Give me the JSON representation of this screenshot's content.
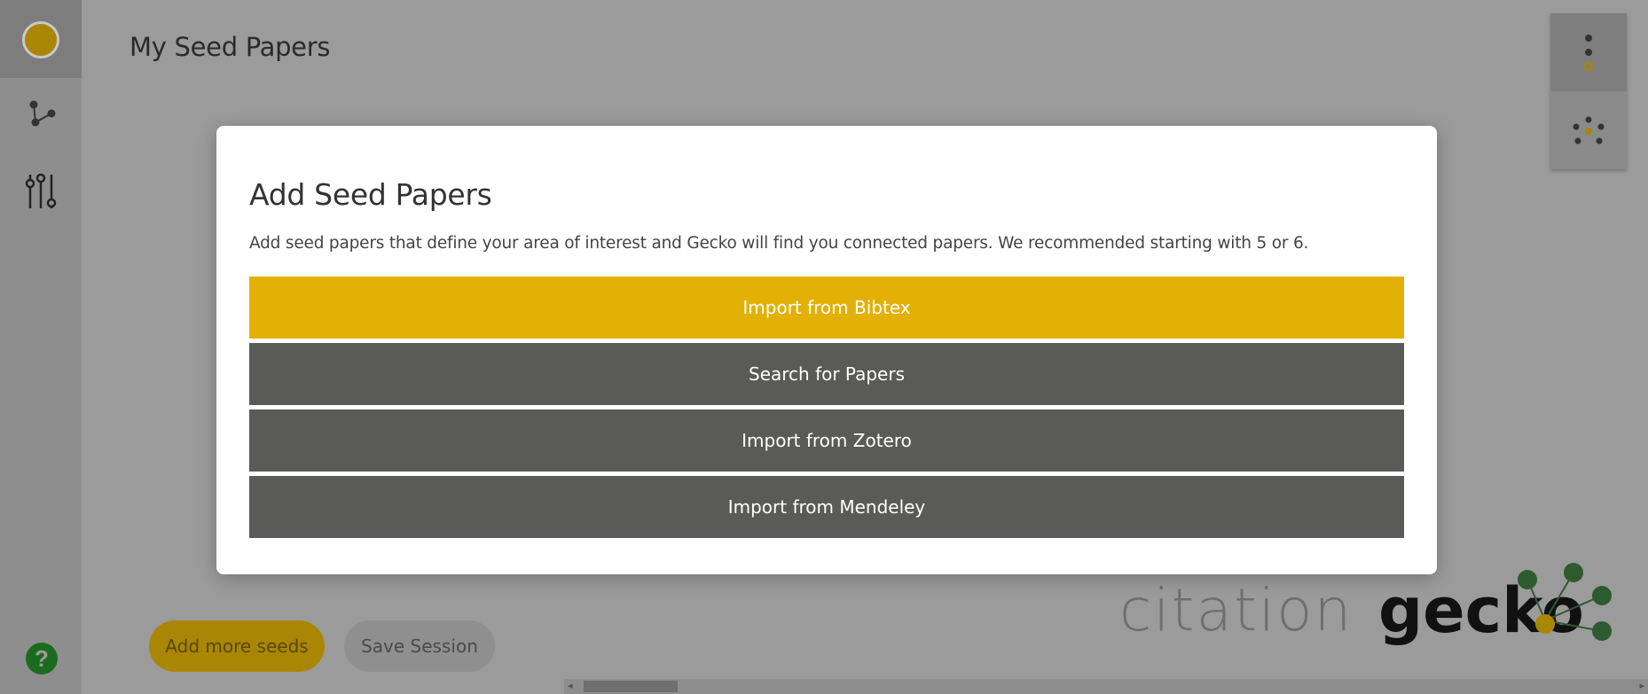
{
  "app": {
    "page_title": "My Seed Papers"
  },
  "sidebar": {
    "items": [
      {
        "name": "home",
        "icon": "circle-logo-icon"
      },
      {
        "name": "network",
        "icon": "network-graph-icon"
      },
      {
        "name": "filters",
        "icon": "sliders-icon"
      }
    ],
    "help_label": "?"
  },
  "right_tools": {
    "items": [
      {
        "icon": "vertical-dots-icon"
      },
      {
        "icon": "cluster-graph-icon"
      }
    ]
  },
  "modal": {
    "title": "Add Seed Papers",
    "description": "Add seed papers that define your area of interest and Gecko will find you connected papers. We recommended starting with 5 or 6.",
    "options": [
      {
        "label": "Import from Bibtex"
      },
      {
        "label": "Search for Papers"
      },
      {
        "label": "Import from Zotero"
      },
      {
        "label": "Import from Mendeley"
      }
    ]
  },
  "footer": {
    "add_more_label": "Add more seeds",
    "save_label": "Save Session"
  },
  "logo": {
    "word1": "citation",
    "word2": "gecko"
  },
  "scrollbar": {
    "left_arrow": "◂",
    "right_arrow": "▸"
  },
  "colors": {
    "accent": "#e3b005",
    "dark_button": "#5a5a58",
    "logo_green": "#2e5a2f",
    "help_green": "#1b6b1f"
  }
}
